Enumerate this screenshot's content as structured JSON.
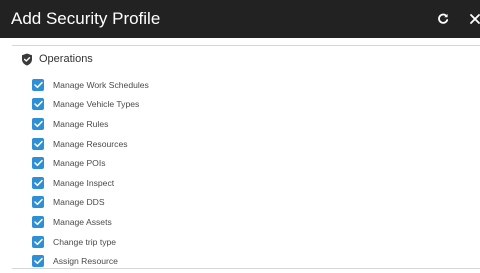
{
  "dialog": {
    "title": "Add Security Profile",
    "header_bg": "#222222",
    "icons": [
      "refresh-icon",
      "close-icon"
    ]
  },
  "section": {
    "icon": "shield-check-icon",
    "label": "Operations"
  },
  "permissions": [
    {
      "label": "Manage Work Schedules",
      "checked": true
    },
    {
      "label": "Manage Vehicle Types",
      "checked": true
    },
    {
      "label": "Manage Rules",
      "checked": true
    },
    {
      "label": "Manage Resources",
      "checked": true
    },
    {
      "label": "Manage POIs",
      "checked": true
    },
    {
      "label": "Manage Inspect",
      "checked": true
    },
    {
      "label": "Manage DDS",
      "checked": true
    },
    {
      "label": "Manage Assets",
      "checked": true
    },
    {
      "label": "Change trip type",
      "checked": true
    },
    {
      "label": "Assign Resource",
      "checked": true
    }
  ],
  "colors": {
    "checkbox": "#2f8fd4",
    "divider": "#d6d6d6"
  }
}
